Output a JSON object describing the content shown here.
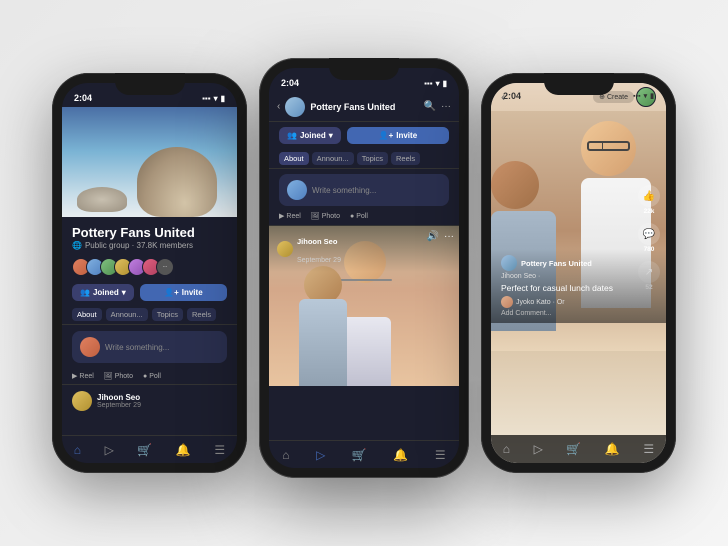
{
  "scene": {
    "bg_color": "#f0f0f0"
  },
  "phone1": {
    "status_time": "2:04",
    "group_name": "Pottery Fans United",
    "group_meta": "Public group · 37.8K members",
    "btn_joined": "Joined",
    "btn_invite": "Invite",
    "tabs": [
      "About",
      "Announcements",
      "Topics",
      "Reels"
    ],
    "post_placeholder": "Write something...",
    "actions": [
      "Reel",
      "Photo",
      "Poll"
    ],
    "feed_user": "Jihoon Seo",
    "feed_date": "September 29"
  },
  "phone2": {
    "status_time": "2:04",
    "header_title": "Pottery Fans United",
    "btn_joined": "Joined",
    "btn_invite": "Invite",
    "tabs": [
      "About",
      "Announcements",
      "Topics",
      "Reels"
    ],
    "post_placeholder": "Write something...",
    "actions": [
      "Reel",
      "Photo",
      "Poll"
    ],
    "feed_user": "Jihoon Seo",
    "feed_date": "September 29"
  },
  "phone3": {
    "status_time": "2:04",
    "create_label": "Create",
    "group_name": "Pottery Fans United",
    "author": "Jihoon Seo ·",
    "caption": "Perfect for casual lunch dates",
    "commenter": "Jyoko Kato · Or",
    "add_comment": "Add Comment...",
    "likes": "22k",
    "comments": "780",
    "shares": "52"
  }
}
